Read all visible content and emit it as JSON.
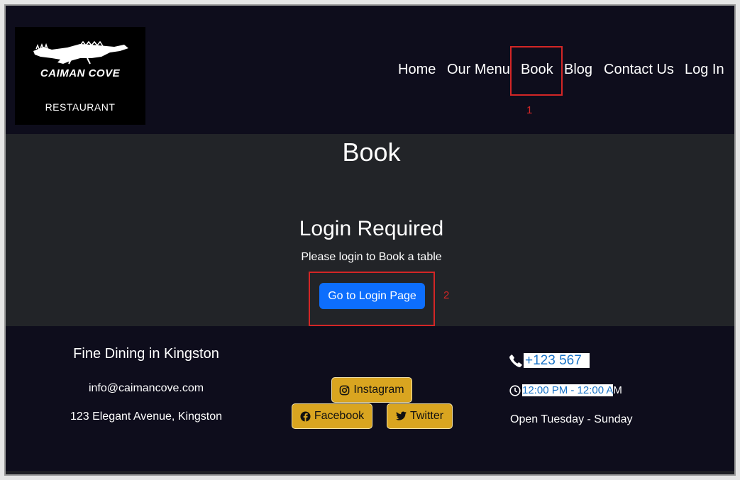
{
  "header": {
    "logo": {
      "name": "CAIMAN COVE",
      "subtitle": "RESTAURANT",
      "icon": "crocodile-icon"
    },
    "nav": [
      "Home",
      "Our Menu",
      "Book",
      "Blog",
      "Contact Us",
      "Log In"
    ]
  },
  "annotations": [
    "1",
    "2"
  ],
  "main": {
    "title": "Book",
    "login_heading": "Login Required",
    "login_text": "Please login to Book a table",
    "login_button": "Go to Login Page"
  },
  "footer": {
    "title": "Fine Dining in Kingston",
    "email": "info@caimancove.com",
    "address": "123 Elegant Avenue, Kingston",
    "social": {
      "instagram": {
        "label": "Instagram",
        "icon": "instagram-icon"
      },
      "facebook": {
        "label": "Facebook",
        "icon": "facebook-icon"
      },
      "twitter": {
        "label": "Twitter",
        "icon": "twitter-icon"
      }
    },
    "phone": "+123 567",
    "hours_selected": "12:00 PM - 12:00 A",
    "hours_rest": "M",
    "open_days": "Open Tuesday - Sunday"
  },
  "colors": {
    "header_bg": "#0e0d1c",
    "main_bg": "#222428",
    "primary_button": "#0d6efd",
    "social_button": "#d9a520",
    "annotation": "#d32626",
    "link": "#1a73c7"
  }
}
